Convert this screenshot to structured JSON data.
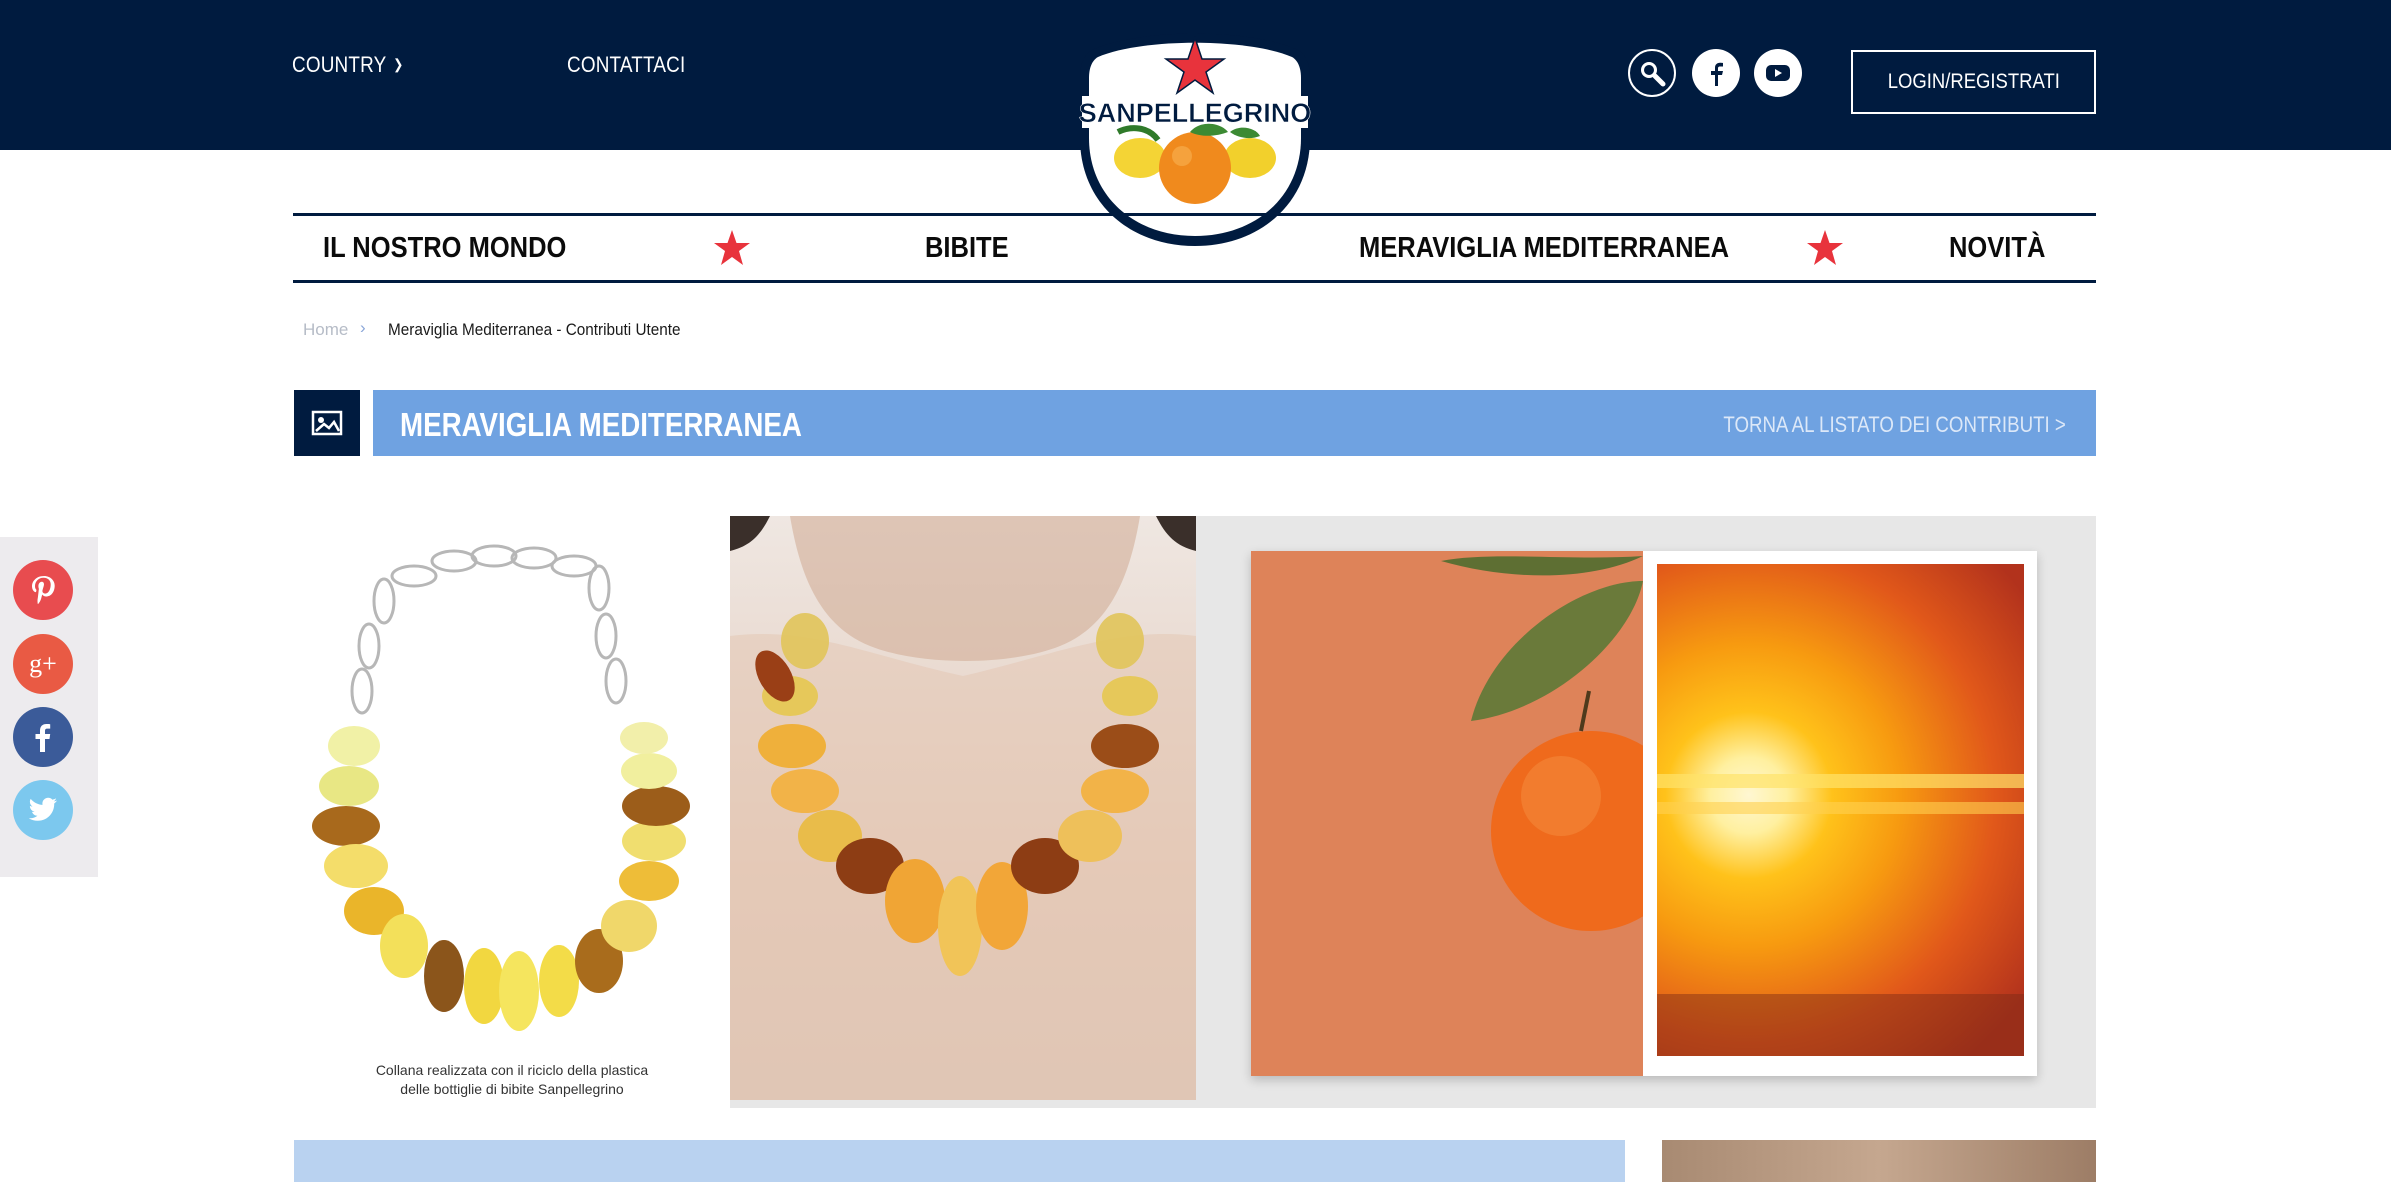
{
  "header": {
    "country_label": "COUNTRY",
    "contact_label": "CONTATTACI",
    "login_label": "LOGIN/REGISTRATI",
    "icons": [
      "search-icon",
      "facebook-icon",
      "youtube-icon"
    ]
  },
  "logo": {
    "text": "SANPELLEGRINO"
  },
  "nav": {
    "items": [
      {
        "label": "IL NOSTRO MONDO"
      },
      {
        "label": "BIBITE"
      },
      {
        "label": "MERAVIGLIA MEDITERRANEA"
      },
      {
        "label": "NOVITÀ"
      }
    ]
  },
  "breadcrumb": {
    "home": "Home",
    "separator": "›",
    "current": "Meraviglia Mediterranea - Contributi Utente"
  },
  "section": {
    "title": "MERAVIGLIA MEDITERRANEA",
    "back_link": "TORNA AL LISTATO DEI CONTRIBUTI >"
  },
  "share": {
    "icons": [
      "pinterest-icon",
      "google-plus-icon",
      "facebook-icon",
      "twitter-icon"
    ],
    "google_plus_text": "g+"
  },
  "gallery": {
    "caption_line1": "Collana realizzata con il riciclo della plastica",
    "caption_line2": "delle bottiglie di bibite Sanpellegrino"
  },
  "colors": {
    "navy": "#001b3f",
    "section_blue": "#6fa2e1",
    "star_red": "#e8333c",
    "pinterest": "#e84c4f",
    "google_plus": "#e95a44",
    "facebook": "#3b5b99",
    "twitter": "#7cc8ee"
  }
}
